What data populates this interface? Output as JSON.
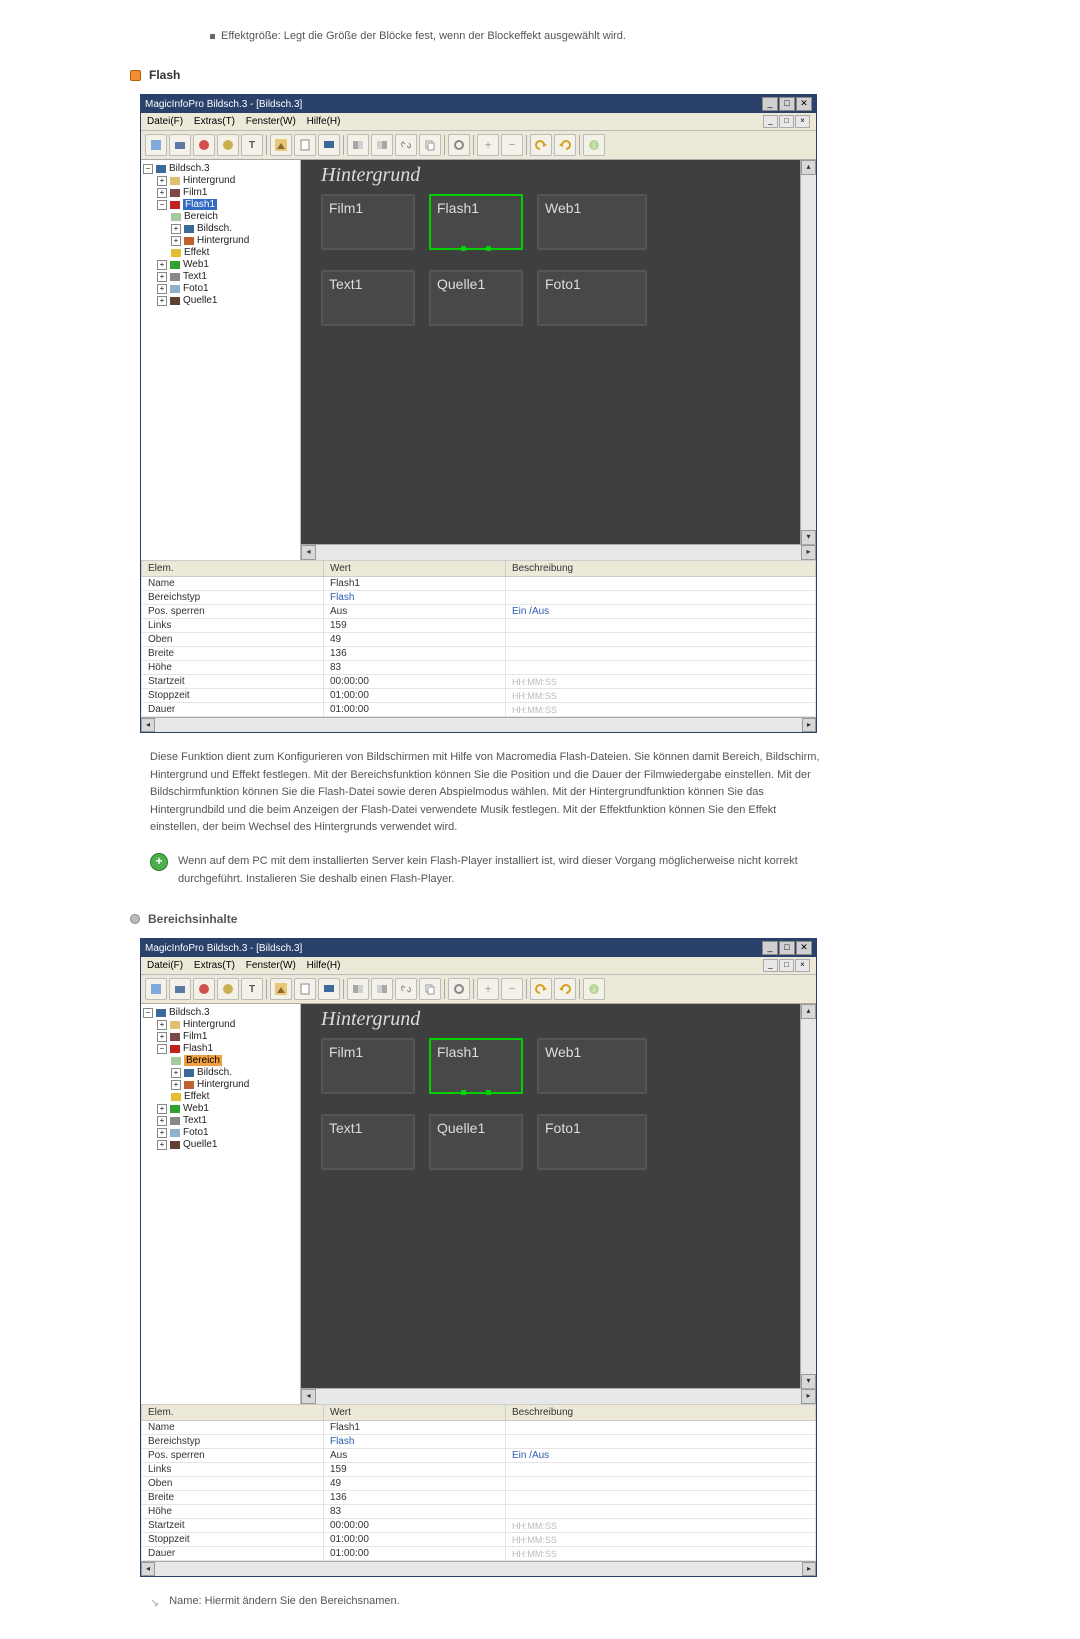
{
  "intro_bullet": "Effektgröße: Legt die Größe der Blöcke fest, wenn der Blockeffekt ausgewählt wird.",
  "section_flash": "Flash",
  "section_bereich": "Bereichsinhalte",
  "app": {
    "title": "MagicInfoPro Bildsch.3 - [Bildsch.3]",
    "menus": {
      "datei": "Datei(F)",
      "extras": "Extras(T)",
      "fenster": "Fenster(W)",
      "hilfe": "Hilfe(H)"
    }
  },
  "tree1": {
    "root": "Bildsch.3",
    "hg": "Hintergrund",
    "film": "Film1",
    "flash": "Flash1",
    "bereich": "Bereich",
    "bildsch": "Bildsch.",
    "hg2": "Hintergrund",
    "effekt": "Effekt",
    "web": "Web1",
    "text": "Text1",
    "foto": "Foto1",
    "quelle": "Quelle1"
  },
  "tree2_hl": "Bereich",
  "canvas": {
    "title": "Hintergrund",
    "b1": "Film1",
    "b2": "Flash1",
    "b3": "Web1",
    "b4": "Text1",
    "b5": "Quelle1",
    "b6": "Foto1"
  },
  "props": {
    "h_elem": "Elem.",
    "h_wert": "Wert",
    "h_besch": "Beschreibung",
    "rows": [
      {
        "e": "Name",
        "w": "Flash1",
        "d": ""
      },
      {
        "e": "Bereichstyp",
        "w": "Flash",
        "d": "",
        "wlink": true
      },
      {
        "e": "Pos. sperren",
        "w": "Aus",
        "d": "Ein /Aus",
        "dlink": true
      },
      {
        "e": "Links",
        "w": "159",
        "d": ""
      },
      {
        "e": "Oben",
        "w": "49",
        "d": ""
      },
      {
        "e": "Breite",
        "w": "136",
        "d": ""
      },
      {
        "e": "Höhe",
        "w": "83",
        "d": ""
      },
      {
        "e": "Startzeit",
        "w": "00:00:00",
        "d": "HH:MM:SS"
      },
      {
        "e": "Stoppzeit",
        "w": "01:00:00",
        "d": "HH:MM:SS"
      },
      {
        "e": "Dauer",
        "w": "01:00:00",
        "d": "HH:MM:SS"
      }
    ]
  },
  "para_flash": "Diese Funktion dient zum Konfigurieren von Bildschirmen mit Hilfe von Macromedia Flash-Dateien. Sie können damit Bereich, Bildschirm, Hintergrund und Effekt festlegen. Mit der Bereichsfunktion können Sie die Position und die Dauer der Filmwiedergabe einstellen. Mit der Bildschirmfunktion können Sie die Flash-Datei sowie deren Abspielmodus wählen. Mit der Hintergrundfunktion können Sie das Hintergrundbild und die beim Anzeigen der Flash-Datei verwendete Musik festlegen. Mit der Effektfunktion können Sie den Effekt einstellen, der beim Wechsel des Hintergrunds verwendet wird.",
  "note_flash": "Wenn auf dem PC mit dem installierten Server kein Flash-Player installiert ist, wird dieser Vorgang möglicherweise nicht korrekt durchgeführt. Instalieren Sie deshalb einen Flash-Player.",
  "foot_line": "Name: Hiermit ändern Sie den Bereichsnamen."
}
